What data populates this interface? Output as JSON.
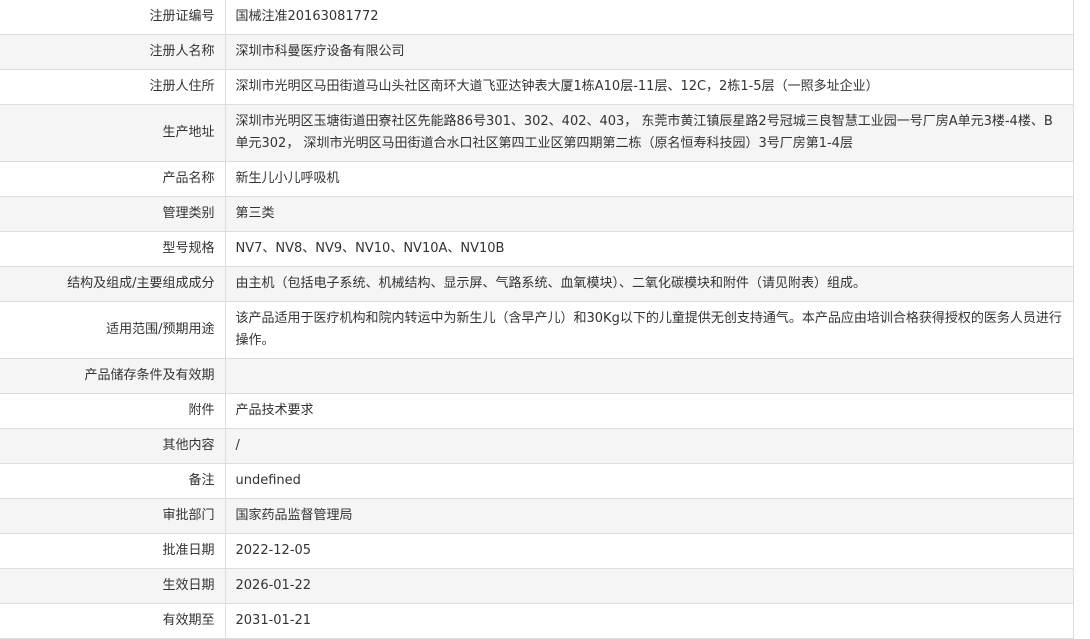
{
  "rows": [
    {
      "label": "注册证编号",
      "value": "国械注准20163081772"
    },
    {
      "label": "注册人名称",
      "value": "深圳市科曼医疗设备有限公司"
    },
    {
      "label": "注册人住所",
      "value": "深圳市光明区马田街道马山头社区南环大道飞亚达钟表大厦1栋A10层-11层、12C，2栋1-5层（一照多址企业）"
    },
    {
      "label": "生产地址",
      "value": "深圳市光明区玉塘街道田寮社区先能路86号301、302、402、403， 东莞市黄江镇辰星路2号冠城三良智慧工业园一号厂房A单元3楼-4楼、B单元302， 深圳市光明区马田街道合水口社区第四工业区第四期第二栋（原名恒寿科技园）3号厂房第1-4层"
    },
    {
      "label": "产品名称",
      "value": "新生儿小儿呼吸机"
    },
    {
      "label": "管理类别",
      "value": "第三类"
    },
    {
      "label": "型号规格",
      "value": "NV7、NV8、NV9、NV10、NV10A、NV10B"
    },
    {
      "label": "结构及组成/主要组成成分",
      "value": "由主机（包括电子系统、机械结构、显示屏、气路系统、血氧模块）、二氧化碳模块和附件（请见附表）组成。"
    },
    {
      "label": "适用范围/预期用途",
      "value": "该产品适用于医疗机构和院内转运中为新生儿（含早产儿）和30Kg以下的儿童提供无创支持通气。本产品应由培训合格获得授权的医务人员进行操作。"
    },
    {
      "label": "产品储存条件及有效期",
      "value": ""
    },
    {
      "label": "附件",
      "value": "产品技术要求"
    },
    {
      "label": "其他内容",
      "value": "/"
    },
    {
      "label": "备注",
      "value": "undefined"
    },
    {
      "label": "审批部门",
      "value": "国家药品监督管理局"
    },
    {
      "label": "批准日期",
      "value": "2022-12-05"
    },
    {
      "label": "生效日期",
      "value": "2026-01-22"
    },
    {
      "label": "有效期至",
      "value": "2031-01-21"
    }
  ]
}
